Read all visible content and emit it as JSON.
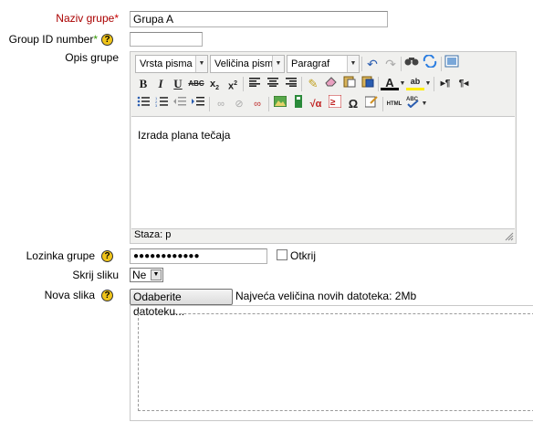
{
  "fields": {
    "group_name": {
      "label": "Naziv grupe",
      "required_mark": "*",
      "value": "Grupa A"
    },
    "group_id": {
      "label": "Group ID number",
      "required_mark": "*",
      "help": "?",
      "value": ""
    },
    "description": {
      "label": "Opis grupe",
      "font_family_select": "Vrsta pisma",
      "font_size_select": "Veličina pisma",
      "format_select": "Paragraf",
      "content": "Izrada plana tečaja",
      "status": "Staza: p"
    },
    "password": {
      "label": "Lozinka grupe",
      "help": "?",
      "value": "●●●●●●●●●●●●",
      "reveal_label": "Otkrij"
    },
    "hide_picture": {
      "label": "Skrij sliku",
      "value": "Ne"
    },
    "new_picture": {
      "label": "Nova slika",
      "help": "?",
      "button": "Odaberite datoteku...",
      "max_size_text": "Najveća veličina novih datoteka: 2Mb"
    }
  },
  "toolbar_icons": {
    "row1": [
      "undo-icon",
      "redo-icon",
      "find-icon",
      "replace-icon",
      "fullscreen-icon"
    ],
    "row2": [
      "bold-icon",
      "italic-icon",
      "underline-icon",
      "strikethrough-icon",
      "subscript-icon",
      "superscript-icon",
      "align-left-icon",
      "align-center-icon",
      "align-right-icon",
      "clear-formatting-icon",
      "eraser-icon",
      "paste-text-icon",
      "paste-word-icon",
      "text-color-icon",
      "background-color-icon",
      "ltr-icon",
      "rtl-icon"
    ],
    "row3": [
      "unordered-list-icon",
      "ordered-list-icon",
      "outdent-icon",
      "indent-icon",
      "link-icon",
      "unlink-icon",
      "anchor-icon",
      "image-icon",
      "media-icon",
      "equation-icon",
      "special-char-icon",
      "omega-icon",
      "edit-icon",
      "html-icon",
      "spellcheck-icon"
    ]
  },
  "colors": {
    "required_label": "#aa0000",
    "required_star": "#cc0000",
    "optional_star": "#339900",
    "help_icon": "#f0c419"
  }
}
